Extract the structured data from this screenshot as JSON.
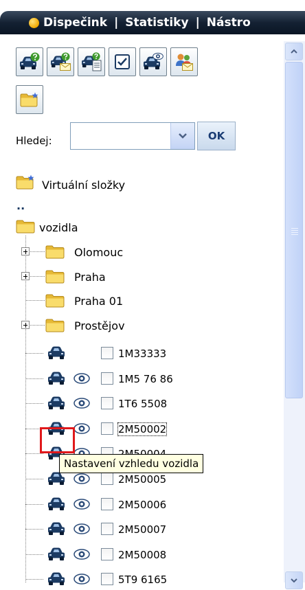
{
  "menu": {
    "items": [
      "Dispečink",
      "Statistiky",
      "Nástro"
    ]
  },
  "toolbar": {
    "buttons": [
      {
        "icon": "car-question-icon"
      },
      {
        "icon": "car-mail-question-icon"
      },
      {
        "icon": "car-document-icon"
      },
      {
        "icon": "checkbox-icon"
      },
      {
        "icon": "car-eye-icon"
      },
      {
        "icon": "people-mail-icon"
      }
    ],
    "second_row": [
      {
        "icon": "new-folder-icon"
      }
    ]
  },
  "search": {
    "label": "Hledej:",
    "value": "",
    "ok_label": "OK"
  },
  "tree": {
    "virtual_folders_label": "Virtuální složky",
    "parent_link": "..",
    "root_label": "vozidla",
    "folders": [
      "Olomouc",
      "Praha",
      "Praha 01",
      "Prostějov"
    ],
    "vehicles": [
      {
        "plate": "1M33333",
        "eye": false
      },
      {
        "plate": "1M5 76 86",
        "eye": true
      },
      {
        "plate": "1T6 5508",
        "eye": true
      },
      {
        "plate": "2M50002",
        "eye": true,
        "focused": true
      },
      {
        "plate": "2M50004",
        "eye": true
      },
      {
        "plate": "2M50005",
        "eye": true
      },
      {
        "plate": "2M50006",
        "eye": true
      },
      {
        "plate": "2M50007",
        "eye": true
      },
      {
        "plate": "2M50008",
        "eye": true
      },
      {
        "plate": "5T9 6165",
        "eye": true
      }
    ]
  },
  "tooltip": {
    "text": "Nastavení vzhledu vozidla"
  },
  "colors": {
    "menu_bar": "#142133",
    "highlight": "#e0181b",
    "tooltip_bg": "#ffffe1",
    "folder": "#f5d45b"
  }
}
